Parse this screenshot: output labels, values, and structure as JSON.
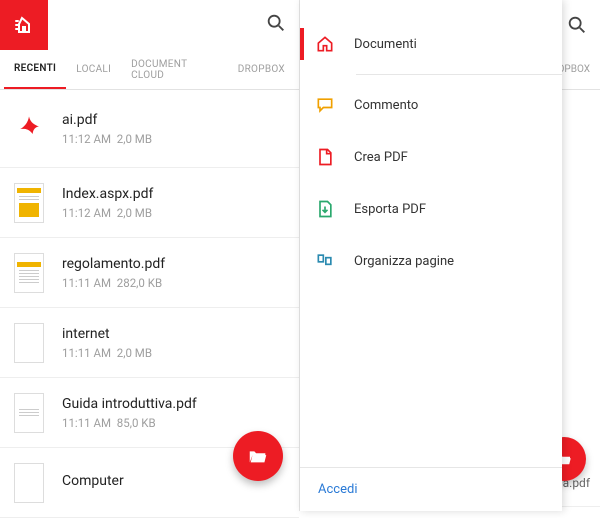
{
  "colors": {
    "accent": "#ed1c24",
    "link": "#2a7ad6"
  },
  "left": {
    "tabs": [
      "RECENTI",
      "LOCALI",
      "DOCUMENT CLOUD",
      "DROPBOX"
    ],
    "active_tab": 0,
    "files": [
      {
        "name": "ai.pdf",
        "time": "11:12 AM",
        "size": "2,0 MB",
        "thumb": "adobe"
      },
      {
        "name": "Index.aspx.pdf",
        "time": "11:12 AM",
        "size": "2,0 MB",
        "thumb": "doc1"
      },
      {
        "name": "regolamento.pdf",
        "time": "11:11 AM",
        "size": "282,0 KB",
        "thumb": "doc2"
      },
      {
        "name": "internet",
        "time": "11:11 AM",
        "size": "2,0 MB",
        "thumb": "blank"
      },
      {
        "name": "Guida introduttiva.pdf",
        "time": "11:11 AM",
        "size": "85,0 KB",
        "thumb": "doc3"
      },
      {
        "name": "Computer",
        "time": "",
        "size": "",
        "thumb": "blank"
      }
    ]
  },
  "right_background": {
    "tab_visible": "ROPBOX",
    "file_visible": "a.pdf"
  },
  "drawer": {
    "items": [
      {
        "label": "Documenti",
        "icon": "home-icon",
        "color": "#ed1c24",
        "active": true
      },
      {
        "label": "Commento",
        "icon": "comment-icon",
        "color": "#f0a000"
      },
      {
        "label": "Crea PDF",
        "icon": "create-pdf-icon",
        "color": "#ed1c24"
      },
      {
        "label": "Esporta PDF",
        "icon": "export-pdf-icon",
        "color": "#2aa86d"
      },
      {
        "label": "Organizza pagine",
        "icon": "organize-icon",
        "color": "#2a8ab0"
      }
    ],
    "footer": "Accedi"
  }
}
